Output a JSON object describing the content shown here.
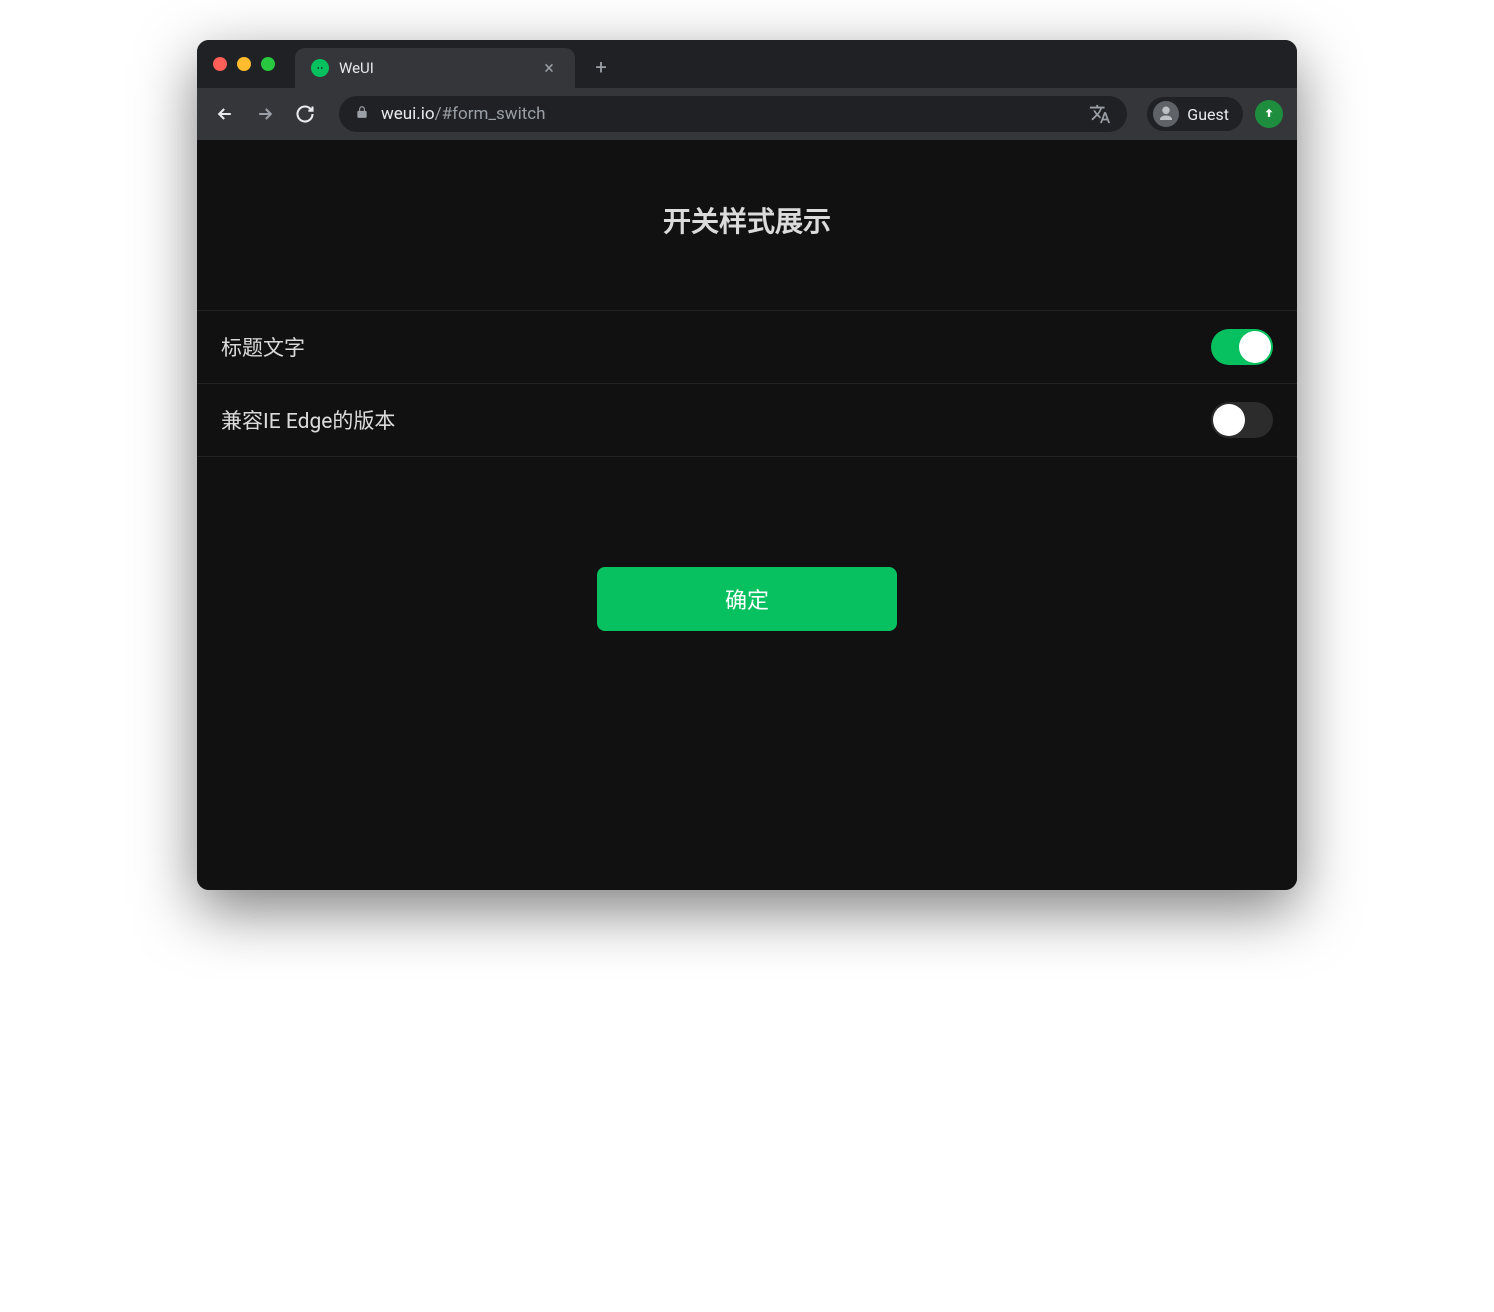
{
  "browser": {
    "tab_title": "WeUI",
    "url_domain": "weui.io",
    "url_path": "/#form_switch",
    "profile_label": "Guest"
  },
  "page": {
    "title": "开关样式展示",
    "cells": [
      {
        "label": "标题文字",
        "switch_on": true
      },
      {
        "label": "兼容IE Edge的版本",
        "switch_on": false
      }
    ],
    "confirm_button": "确定"
  },
  "colors": {
    "accent": "#07c160",
    "page_bg": "#111111",
    "browser_chrome": "#35363a"
  }
}
